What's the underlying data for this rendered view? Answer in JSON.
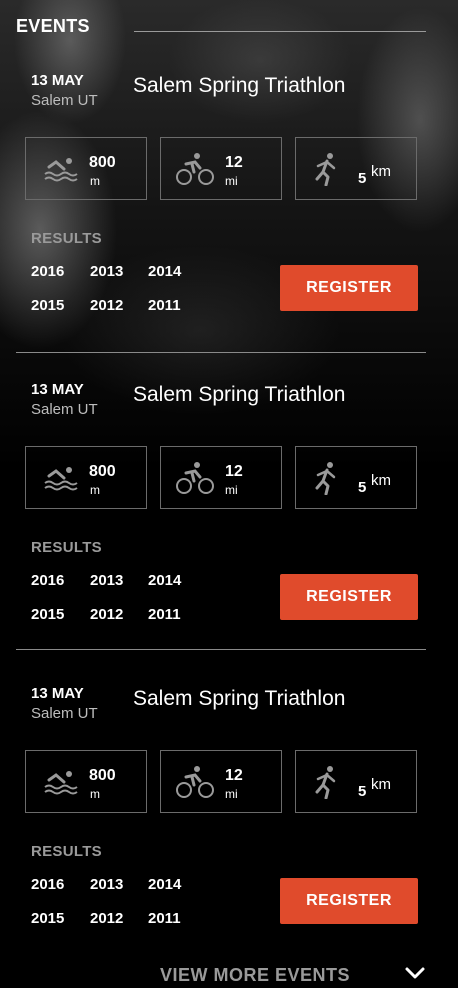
{
  "header": {
    "title": "EVENTS"
  },
  "events": [
    {
      "date": "13 MAY",
      "location": "Salem UT",
      "title": "Salem Spring Triathlon",
      "swim": {
        "value": "800",
        "unit": "m"
      },
      "bike": {
        "value": "12",
        "unit": "mi"
      },
      "run": {
        "value": "5",
        "unit": "km"
      },
      "results_label": "RESULTS",
      "years": [
        "2016",
        "2013",
        "2014",
        "2015",
        "2012",
        "2011"
      ],
      "register_label": "REGISTER"
    },
    {
      "date": "13 MAY",
      "location": "Salem UT",
      "title": "Salem Spring Triathlon",
      "swim": {
        "value": "800",
        "unit": "m"
      },
      "bike": {
        "value": "12",
        "unit": "mi"
      },
      "run": {
        "value": "5",
        "unit": "km"
      },
      "results_label": "RESULTS",
      "years": [
        "2016",
        "2013",
        "2014",
        "2015",
        "2012",
        "2011"
      ],
      "register_label": "REGISTER"
    },
    {
      "date": "13 MAY",
      "location": "Salem UT",
      "title": "Salem Spring Triathlon",
      "swim": {
        "value": "800",
        "unit": "m"
      },
      "bike": {
        "value": "12",
        "unit": "mi"
      },
      "run": {
        "value": "5",
        "unit": "km"
      },
      "results_label": "RESULTS",
      "years": [
        "2016",
        "2013",
        "2014",
        "2015",
        "2012",
        "2011"
      ],
      "register_label": "REGISTER"
    }
  ],
  "footer": {
    "view_more_label": "VIEW MORE EVENTS"
  },
  "colors": {
    "accent": "#e04b2c",
    "background": "#000000",
    "muted": "#9a9a9a"
  },
  "icons": {
    "swim": "swimmer-icon",
    "bike": "cyclist-icon",
    "run": "runner-icon",
    "more": "chevron-down-icon"
  }
}
